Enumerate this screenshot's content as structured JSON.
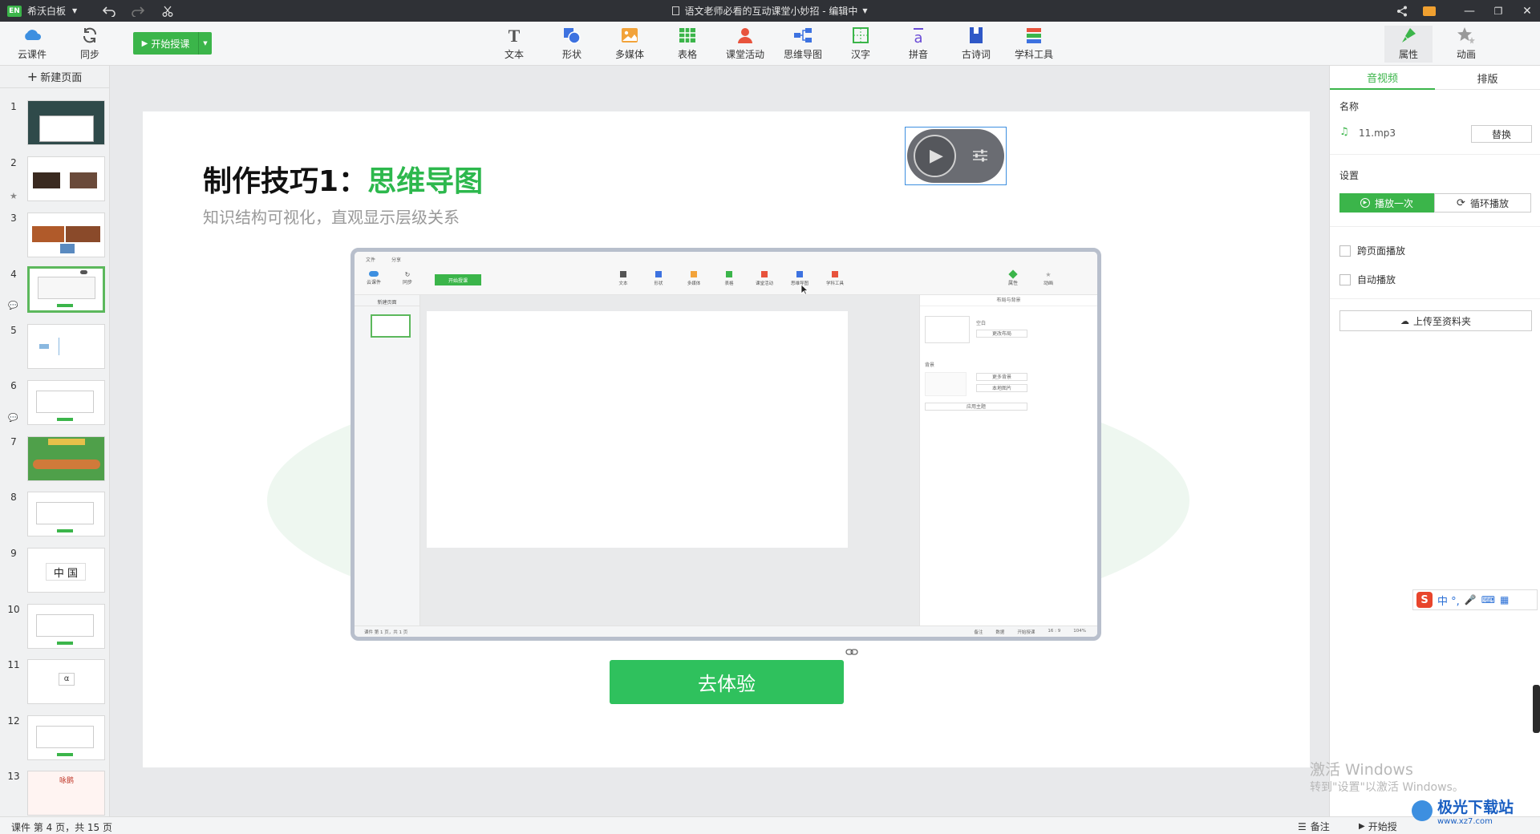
{
  "titlebar": {
    "app_badge": "EN",
    "app_name": "希沃白板",
    "doc_title": "语文老师必看的互动课堂小妙招 - 编辑中"
  },
  "toolbar": {
    "cloud_label": "云课件",
    "sync_label": "同步",
    "start_label": "开始授课",
    "tools": [
      {
        "label": "文本",
        "icon": "text-icon"
      },
      {
        "label": "形状",
        "icon": "shape-icon"
      },
      {
        "label": "多媒体",
        "icon": "media-icon"
      },
      {
        "label": "表格",
        "icon": "table-icon"
      },
      {
        "label": "课堂活动",
        "icon": "activity-icon"
      },
      {
        "label": "思维导图",
        "icon": "mindmap-icon"
      },
      {
        "label": "汉字",
        "icon": "hanzi-icon"
      },
      {
        "label": "拼音",
        "icon": "pinyin-icon"
      },
      {
        "label": "古诗词",
        "icon": "poetry-icon"
      },
      {
        "label": "学科工具",
        "icon": "subject-tools-icon"
      }
    ],
    "props_label": "属性",
    "anim_label": "动画"
  },
  "sidebar": {
    "new_page_label": "新建页面",
    "pages": [
      "1",
      "2",
      "3",
      "4",
      "5",
      "6",
      "7",
      "8",
      "9",
      "10",
      "11",
      "12",
      "13"
    ],
    "thumb9_chars": "中 国",
    "thumb11_char": "α",
    "thumb13_title": "咏鹅"
  },
  "slide": {
    "title_black": "制作技巧1：",
    "title_green": "思维导图",
    "subtitle": "知识结构可视化，直观显示层级关系",
    "cta_label": "去体验",
    "inner": {
      "menu_file": "文件",
      "menu_share": "分享",
      "cloud": "云课件",
      "sync": "同步",
      "start": "开始授课",
      "tools": [
        "文本",
        "形状",
        "多媒体",
        "表格",
        "课堂活动",
        "思维导图",
        "学科工具"
      ],
      "props": "属性",
      "anim": "动画",
      "new_page": "新建页面",
      "panel_title": "布局与背景",
      "blank": "空白",
      "change_layout": "更改布局",
      "background": "背景",
      "more_bg": "更多背景",
      "local_img": "本地图片",
      "apply_theme": "应用主题",
      "status_left": "课件 第 1 页，共 1 页",
      "status_items": [
        "备注",
        "数据",
        "开始授课",
        "16 : 9",
        "104%"
      ]
    }
  },
  "rpanel": {
    "tab_av": "音视频",
    "tab_layout": "排版",
    "name_label": "名称",
    "file_name": "11.mp3",
    "replace_label": "替换",
    "settings_label": "设置",
    "play_once": "播放一次",
    "loop_play": "循环播放",
    "cross_page": "跨页面播放",
    "auto_play": "自动播放",
    "upload_label": "上传至资料夹"
  },
  "statusbar": {
    "page_info": "课件 第 4 页，共 15 页",
    "notes": "备注",
    "start": "开始授"
  },
  "overlay": {
    "activate_title": "激活 Windows",
    "activate_sub": "转到\"设置\"以激活 Windows。",
    "watermark": "极光下载站",
    "watermark_url": "www.xz7.com",
    "ime_chars": "中 °,"
  },
  "colors": {
    "accent": "#3bb54a",
    "title_green": "#2db84d",
    "dark": "#2f3136"
  }
}
